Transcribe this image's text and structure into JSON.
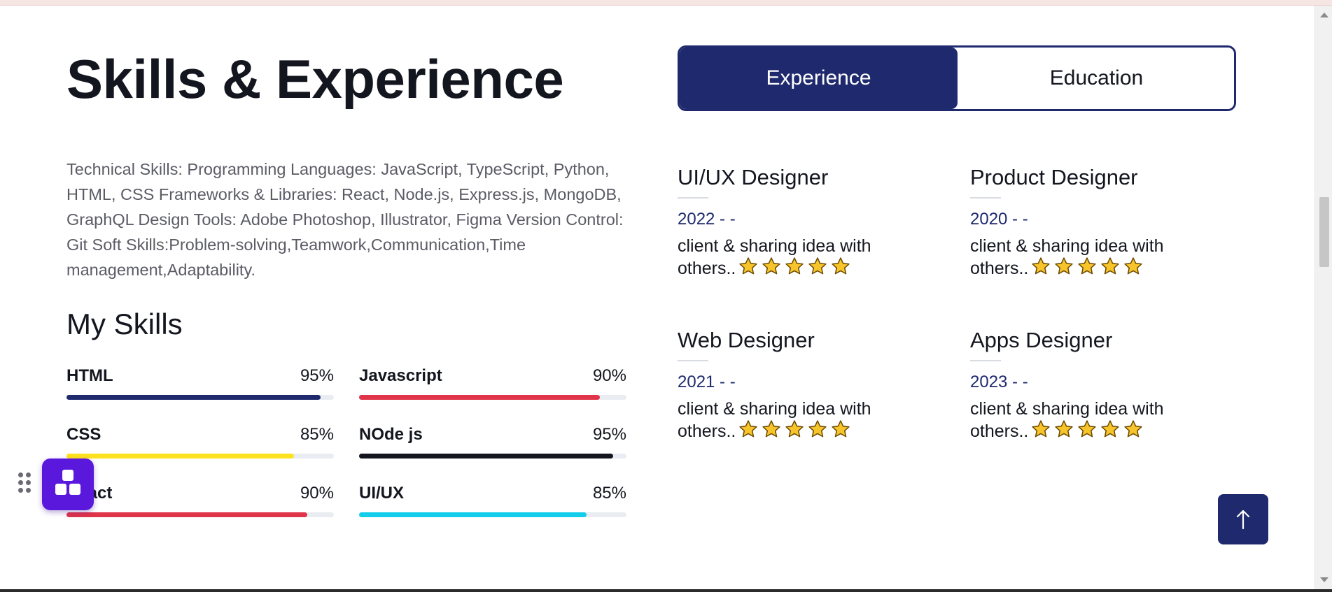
{
  "header": {
    "title": "Skills & Experience"
  },
  "intro": {
    "description": "Technical Skills: Programming Languages: JavaScript, TypeScript, Python, HTML, CSS Frameworks & Libraries: React, Node.js, Express.js, MongoDB, GraphQL Design Tools: Adobe Photoshop, Illustrator, Figma Version Control: Git Soft Skills:Problem-solving,Teamwork,Communication,Time management,Adaptability."
  },
  "skills": {
    "heading": "My Skills",
    "items": [
      {
        "name": "HTML",
        "percent_label": "95%",
        "value": 0.95,
        "color": "#1f2a6e"
      },
      {
        "name": "Javascript",
        "percent_label": "90%",
        "value": 0.9,
        "color": "#e0344a"
      },
      {
        "name": "CSS",
        "percent_label": "85%",
        "value": 0.85,
        "color": "#ffe21f"
      },
      {
        "name": "NOde js",
        "percent_label": "95%",
        "value": 0.95,
        "color": "#14161f"
      },
      {
        "name": "React",
        "percent_label": "90%",
        "value": 0.9,
        "color": "#e0344a"
      },
      {
        "name": "UI/UX",
        "percent_label": "85%",
        "value": 0.85,
        "color": "#14cdeb"
      }
    ]
  },
  "tabs": [
    {
      "label": "Experience",
      "active": true
    },
    {
      "label": "Education",
      "active": false
    }
  ],
  "experience": [
    {
      "title": "UI/UX Designer",
      "year": "2022 - -",
      "description": "client & sharing idea with others..",
      "stars": 5
    },
    {
      "title": "Product Designer",
      "year": "2020 - -",
      "description": "client & sharing idea with others..",
      "stars": 5
    },
    {
      "title": "Web Designer",
      "year": "2021 - -",
      "description": "client & sharing idea with others..",
      "stars": 5
    },
    {
      "title": "Apps Designer",
      "year": "2023 - -",
      "description": "client & sharing idea with others..",
      "stars": 5
    }
  ],
  "icons": {
    "back_to_top": "arrow-up-icon",
    "widget": "blocks-icon",
    "drag": "drag-handle-icon",
    "rating": "star-icon"
  },
  "colors": {
    "primary": "#1f2a6e",
    "widget": "#5a18dc",
    "star": "#f7c52b"
  }
}
